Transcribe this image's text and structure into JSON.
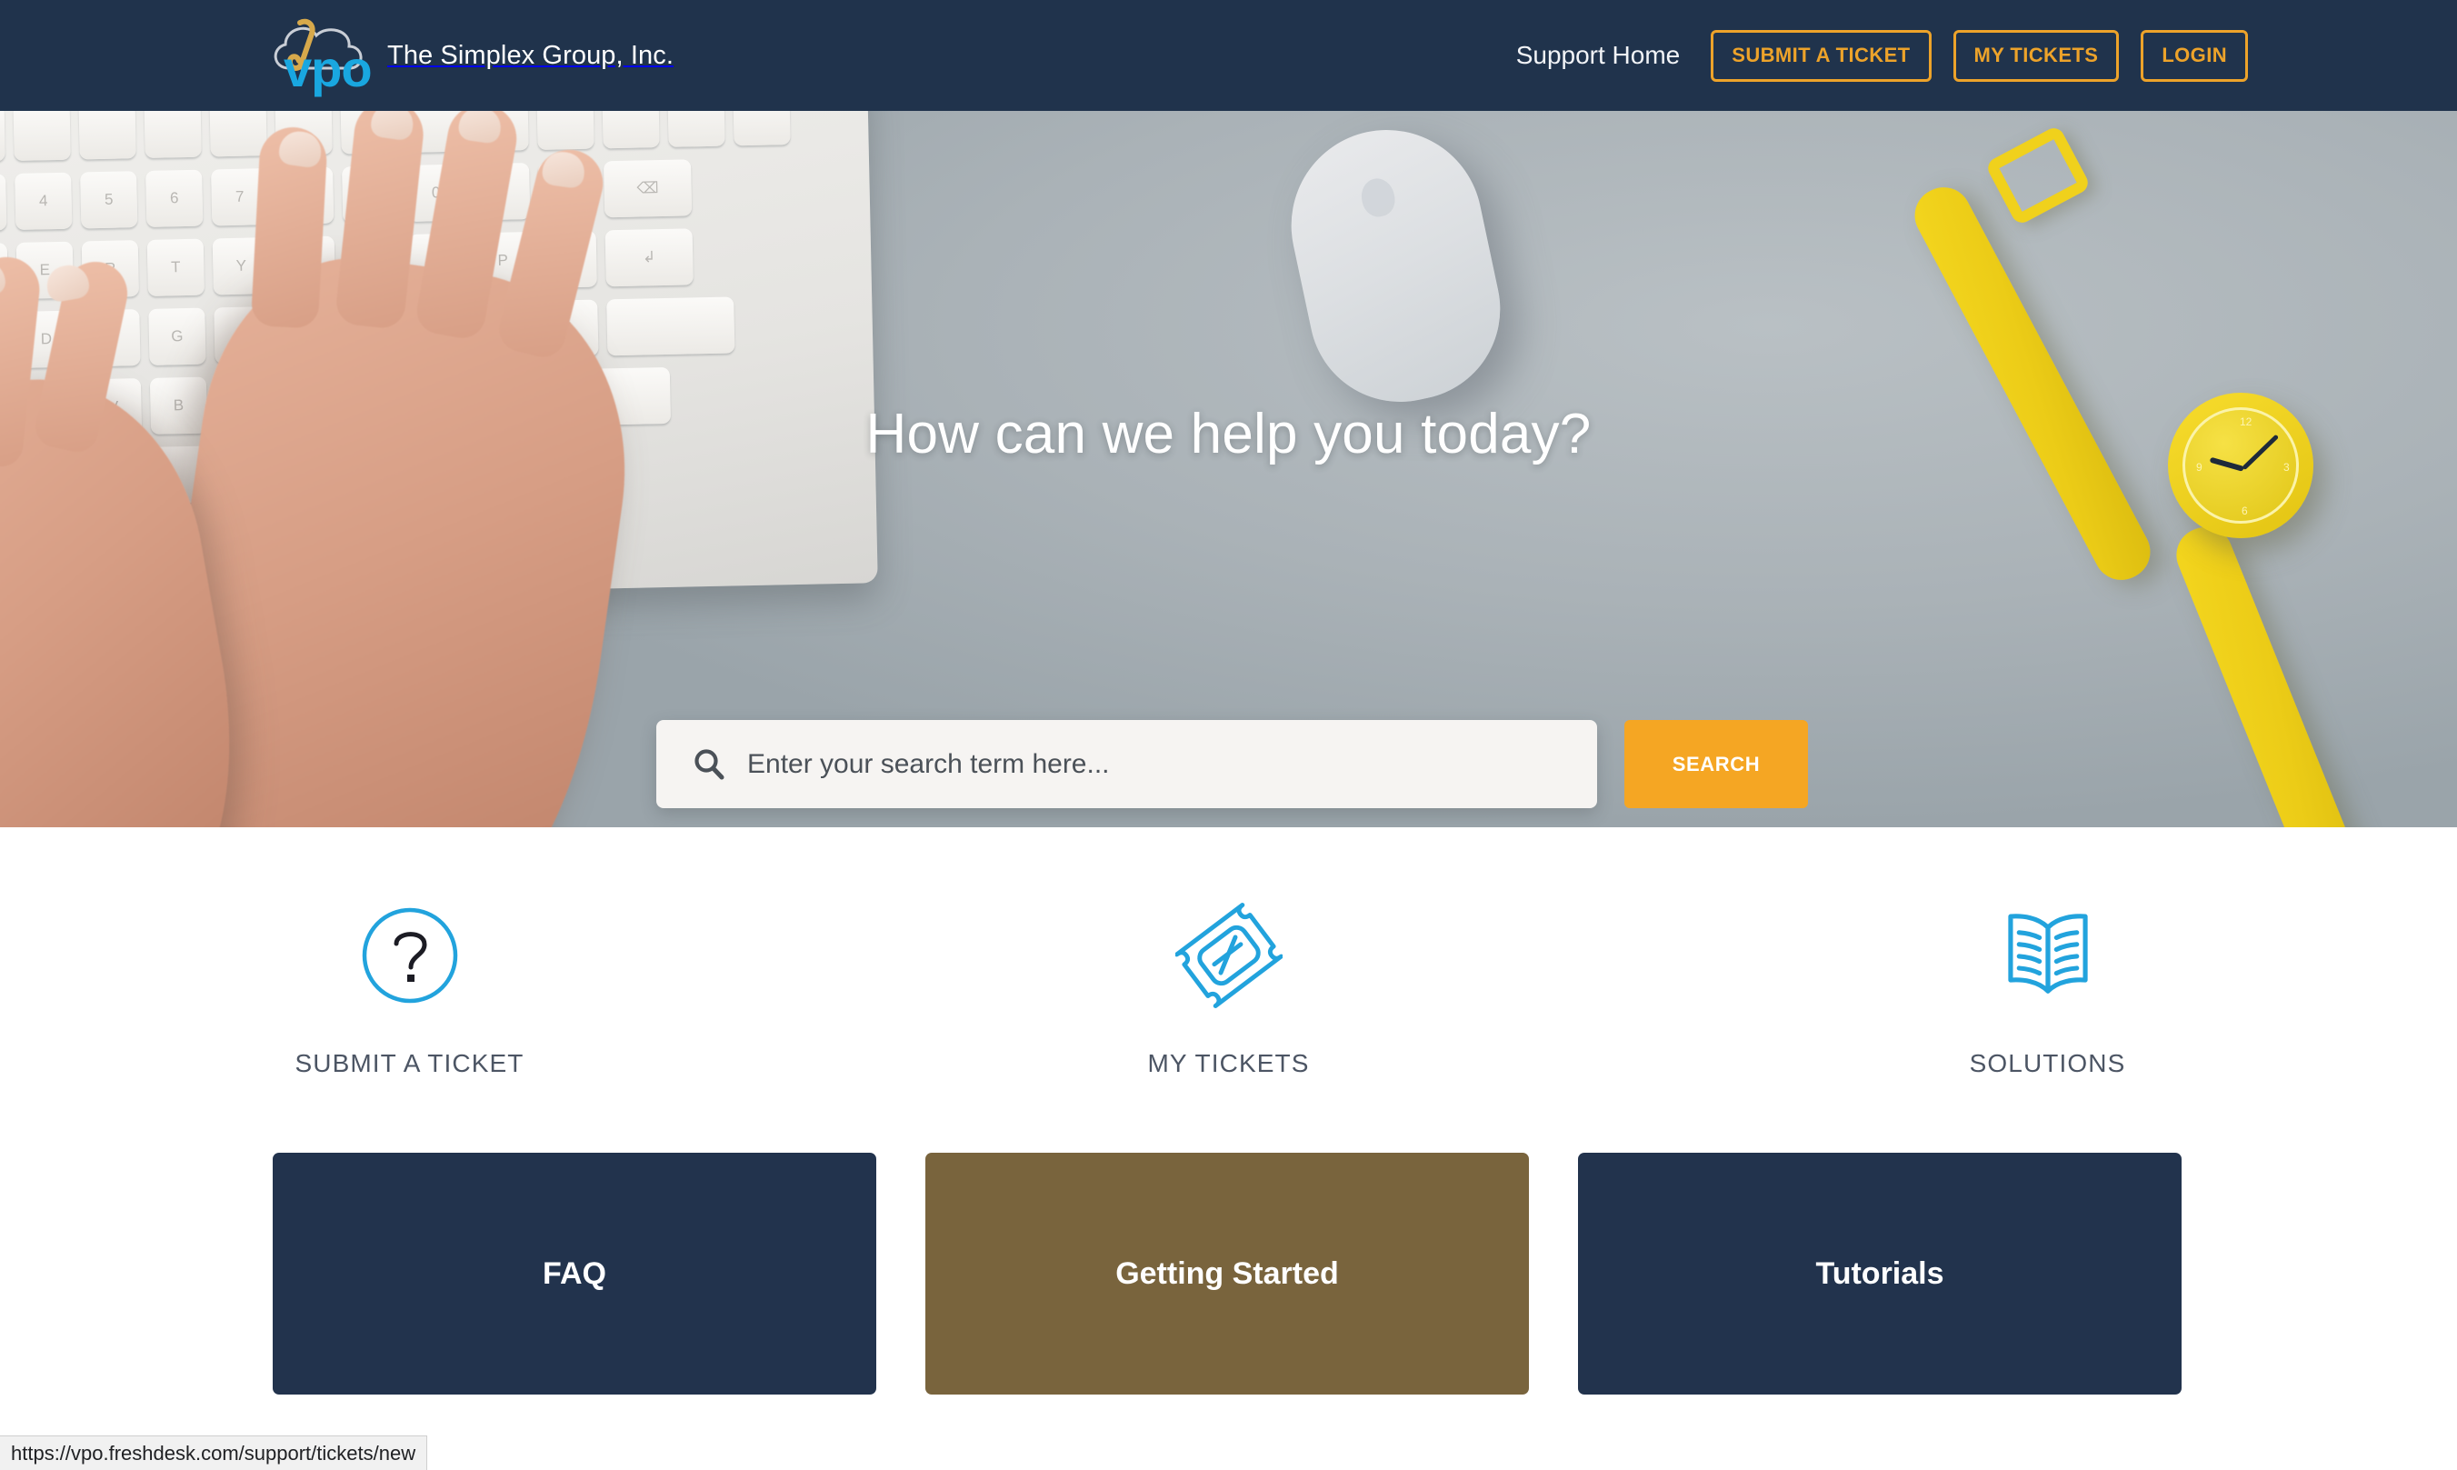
{
  "header": {
    "brand_name": "The Simplex Group, Inc.",
    "logo_text": "vpo",
    "logo_icon": "cloud-paperclip-logo",
    "nav_link": "Support Home",
    "buttons": [
      {
        "label": "SUBMIT A TICKET",
        "name": "submit-a-ticket-button"
      },
      {
        "label": "MY TICKETS",
        "name": "my-tickets-button"
      },
      {
        "label": "LOGIN",
        "name": "login-button"
      }
    ],
    "background_color": "#20334c",
    "accent_color": "#eda32a"
  },
  "hero": {
    "title": "How can we help you today?",
    "image_description": "hands-typing-on-keyboard-with-mouse-and-yellow-watch",
    "search": {
      "placeholder": "Enter your search term here...",
      "value": "",
      "icon": "search-icon",
      "button_label": "SEARCH",
      "button_color": "#f5a623"
    }
  },
  "quicklinks": [
    {
      "label": "SUBMIT A TICKET",
      "icon": "question-mark-circle-icon",
      "name": "quicklink-submit-a-ticket"
    },
    {
      "label": "MY TICKETS",
      "icon": "ticket-icon",
      "name": "quicklink-my-tickets"
    },
    {
      "label": "SOLUTIONS",
      "icon": "open-book-icon",
      "name": "quicklink-solutions"
    }
  ],
  "cards": [
    {
      "label": "FAQ",
      "color": "#22334d",
      "name": "category-card-faq"
    },
    {
      "label": "Getting Started",
      "color": "#79643d",
      "name": "category-card-getting-started"
    },
    {
      "label": "Tutorials",
      "color": "#22334d",
      "name": "category-card-tutorials"
    }
  ],
  "status_bar": {
    "url": "https://vpo.freshdesk.com/support/tickets/new"
  },
  "colors": {
    "icon_blue": "#22a3dd",
    "navy": "#20334c",
    "orange": "#f5a623",
    "olive": "#79643d"
  }
}
